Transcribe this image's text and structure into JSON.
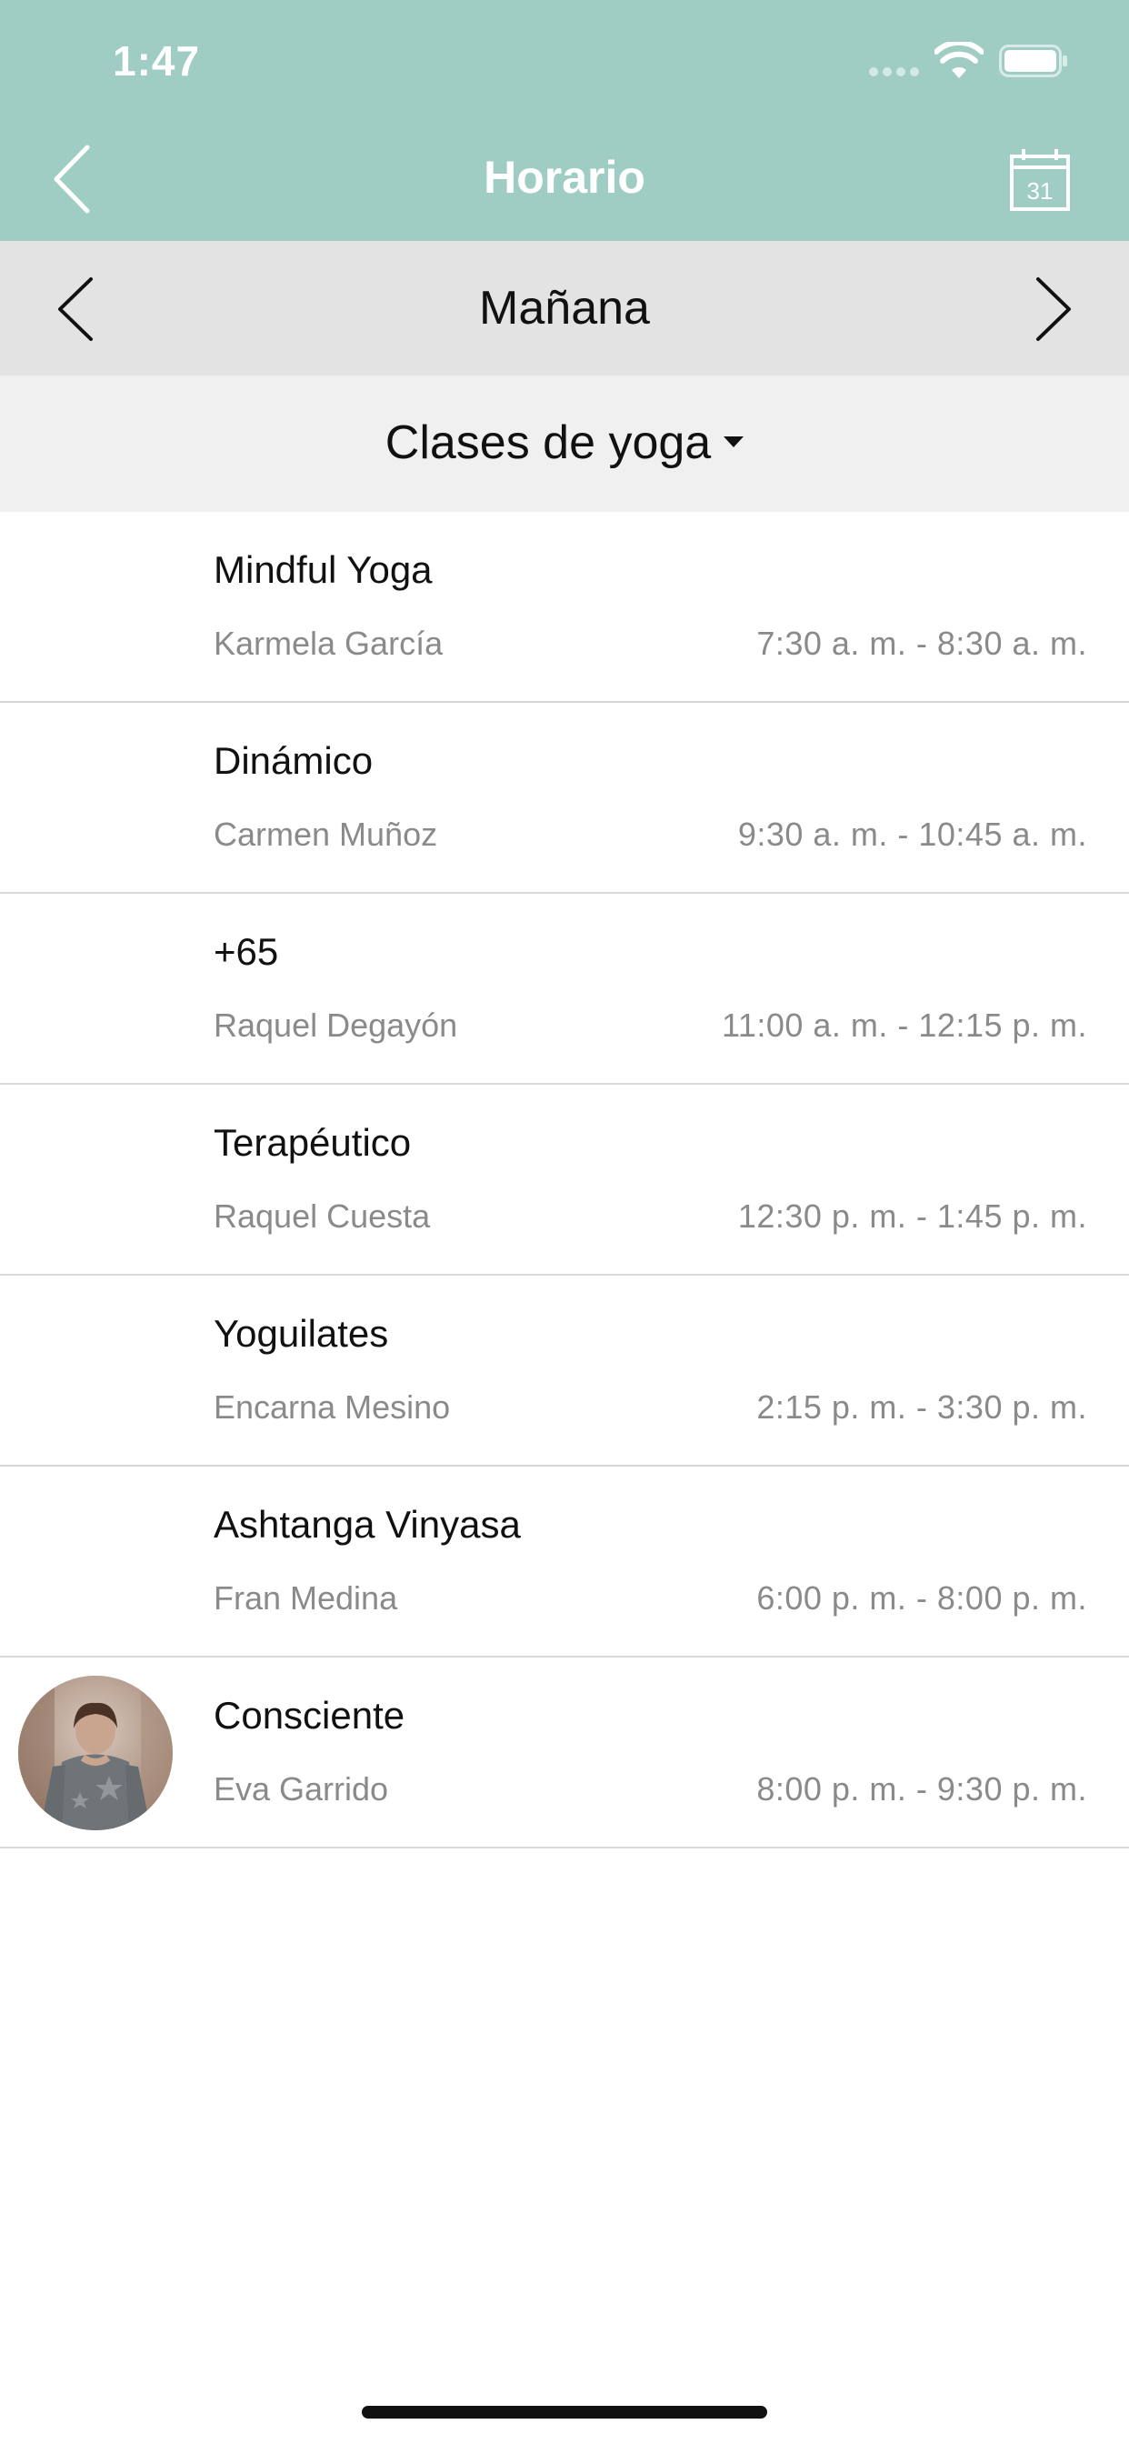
{
  "status_bar": {
    "time": "1:47"
  },
  "nav": {
    "title": "Horario",
    "calendar_day": "31"
  },
  "day_selector": {
    "label": "Mañana"
  },
  "filter": {
    "label": "Clases de yoga"
  },
  "classes": [
    {
      "name": "Mindful Yoga",
      "teacher": "Karmela García",
      "time": "7:30 a. m. - 8:30 a. m."
    },
    {
      "name": "Dinámico",
      "teacher": "Carmen Muñoz",
      "time": "9:30 a. m. - 10:45 a. m."
    },
    {
      "name": "+65",
      "teacher": "Raquel Degayón",
      "time": "11:00 a. m. - 12:15 p. m."
    },
    {
      "name": "Terapéutico",
      "teacher": "Raquel Cuesta",
      "time": "12:30 p. m. - 1:45 p. m."
    },
    {
      "name": "Yoguilates",
      "teacher": "Encarna Mesino",
      "time": "2:15 p. m. - 3:30 p. m."
    },
    {
      "name": "Ashtanga Vinyasa",
      "teacher": "Fran Medina",
      "time": "6:00 p. m. - 8:00 p. m."
    },
    {
      "name": "Consciente",
      "teacher": "Eva Garrido",
      "time": "8:00 p. m. - 9:30 p. m."
    }
  ],
  "colors": {
    "header": "#9fcdc3",
    "day_bar": "#e3e3e3",
    "filter_bar": "#f0f0f0",
    "secondary_text": "#8a8a8a"
  }
}
